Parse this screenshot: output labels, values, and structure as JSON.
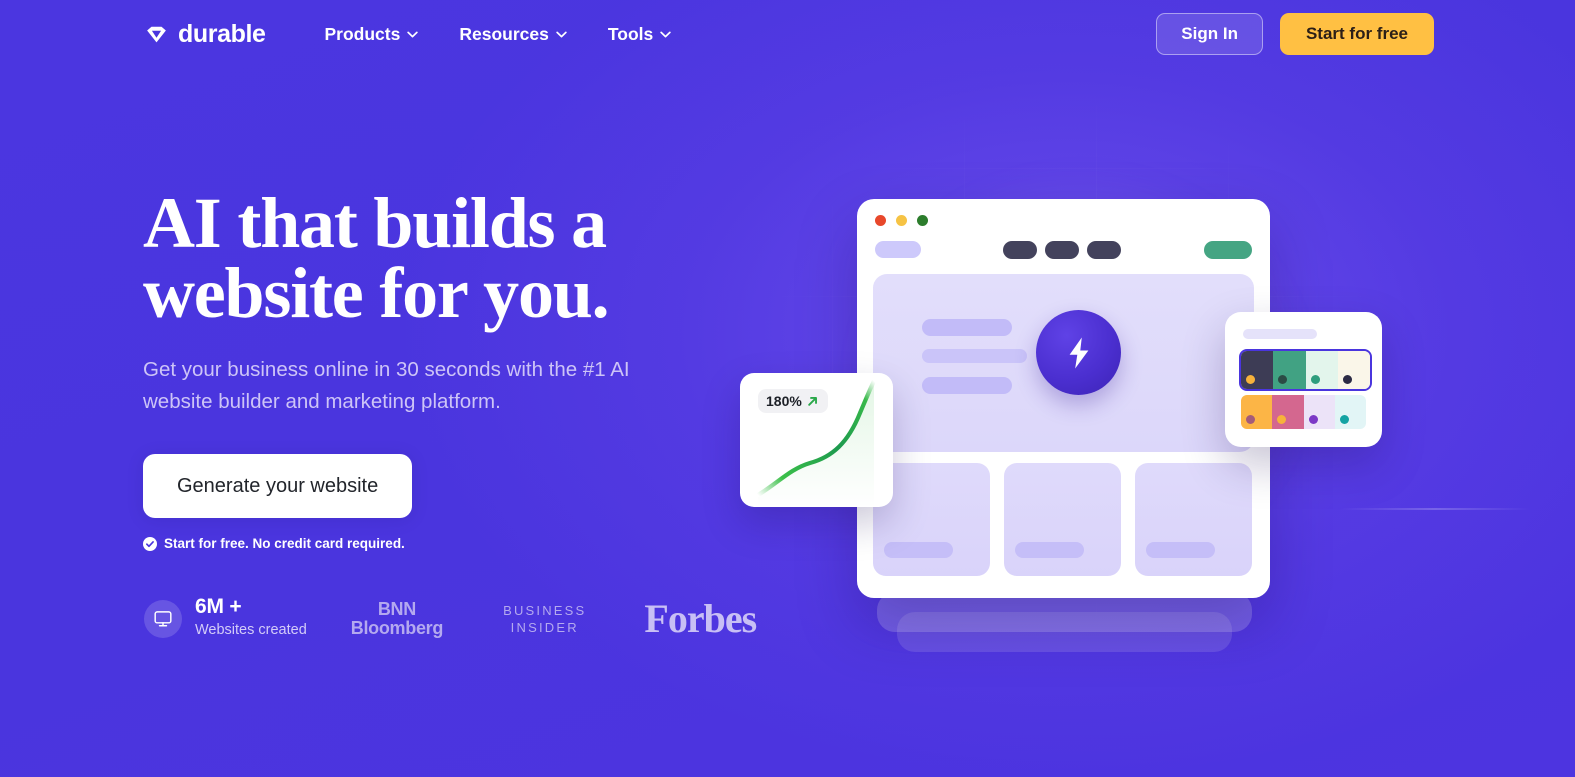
{
  "header": {
    "brand": "durable",
    "brand_icon": "diamond-logo-icon",
    "nav": [
      {
        "label": "Products",
        "icon": "chevron-down-icon"
      },
      {
        "label": "Resources",
        "icon": "chevron-down-icon"
      },
      {
        "label": "Tools",
        "icon": "chevron-down-icon"
      }
    ],
    "sign_in_label": "Sign In",
    "start_free_label": "Start for free"
  },
  "hero": {
    "headline_line1": "AI that builds a",
    "headline_line2": "website for you.",
    "subhead": "Get your business online in 30 seconds with the #1 AI website builder and marketing platform.",
    "cta_label": "Generate your website",
    "cta_note": "Start for free. No credit card required.",
    "cta_note_icon": "check-circle-icon"
  },
  "stats": {
    "icon": "monitor-icon",
    "value": "6M +",
    "label": "Websites created",
    "press_logos": [
      {
        "name": "bnn-bloomberg-logo",
        "line1": "BNN",
        "line2": "Bloomberg"
      },
      {
        "name": "business-insider-logo",
        "line1": "BUSINESS",
        "line2": "INSIDER"
      },
      {
        "name": "forbes-logo",
        "text": "Forbes"
      }
    ]
  },
  "illustration": {
    "browser": {
      "traffic_lights": [
        "#e8482b",
        "#f6c344",
        "#2c7d2c"
      ],
      "toolbar_pills": [
        "#cdc9fb",
        "#43425c",
        "#43425c",
        "#43425c",
        "#45a583"
      ],
      "bolt_icon": "lightning-bolt-icon",
      "placeholder_bars": 3,
      "mini_cards": 3
    },
    "chart_card": {
      "badge_value": "180%",
      "badge_icon": "trend-up-arrow-icon",
      "line_color": "#2aa84a"
    },
    "palette_card": {
      "selected_row": {
        "swatches": [
          "#3d3c55",
          "#41a283",
          "#e3f5ec",
          "#faf6e9"
        ],
        "dots": [
          "#f7b23b",
          "#2b4b45",
          "#2f9e7e",
          "#2c2b45"
        ]
      },
      "second_row": {
        "swatches": [
          "#fcb546",
          "#d4678f",
          "#ece3f8",
          "#e2f5f6"
        ],
        "dots": [
          "#a45b7a",
          "#f7b23b",
          "#7c39c6",
          "#14a3a3"
        ]
      }
    }
  },
  "colors": {
    "background": "#4a35de",
    "accent_amber": "#ffc043",
    "accent_white": "#ffffff",
    "subhead": "#cdc4f7"
  }
}
